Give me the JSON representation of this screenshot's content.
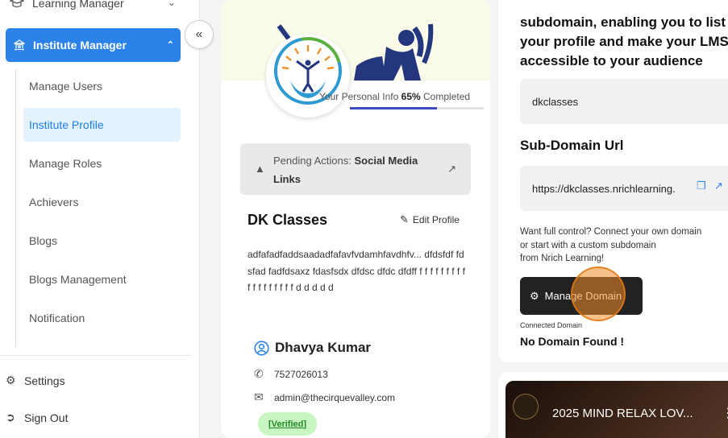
{
  "colors": {
    "primary": "#2b82e8",
    "active_bg": "#e3f2fd",
    "dark_button": "#222222",
    "verified_bg": "#c9f5c2",
    "progress": "#3b4bc4"
  },
  "sidebar": {
    "learning_manager": "Learning Manager",
    "institute_manager": "Institute Manager",
    "items": [
      {
        "label": "Manage Users",
        "active": false
      },
      {
        "label": "Institute Profile",
        "active": true
      },
      {
        "label": "Manage Roles",
        "active": false
      },
      {
        "label": "Achievers",
        "active": false
      },
      {
        "label": "Blogs",
        "active": false
      },
      {
        "label": "Blogs Management",
        "active": false
      },
      {
        "label": "Notification",
        "active": false
      }
    ],
    "settings": "Settings",
    "sign_out": "Sign Out",
    "collapse_icon": "double-chevron-left-icon"
  },
  "profile": {
    "progress_prefix": "Your Personal Info",
    "progress_percent": "65%",
    "progress_value": 0.65,
    "progress_suffix": "Completed",
    "pending_prefix": "Pending Actions:",
    "pending_value": "Social Media Links",
    "institute_name": "DK Classes",
    "edit_label": "Edit Profile",
    "about": "adfafadfaddsaadadfafavfvdamhfavdhfv... dfdsfdf fdsfad fadfdsaxz fdasfsdx dfdsc dfdc dfdff f f f f f f f f f f f f f f f f f f d d d d d",
    "person_name": "Dhavya Kumar",
    "phone": "7527026013",
    "email": "admin@thecirquevalley.com",
    "verified_label": "[Verified]"
  },
  "domain": {
    "intro": "subdomain, enabling you to list your profile and make your LMS accessible to your audience",
    "subdomain_value": "dkclasses",
    "subdomain_url_heading": "Sub-Domain Url",
    "subdomain_url": "https://dkclasses.nrichlearning.",
    "want_line1": "Want full control? Connect your own domain",
    "want_line2": "or start with a custom subdomain",
    "want_line3": "from Nrich Learning!",
    "manage_button": "Manage Domain",
    "connected_label": "Connected Domain",
    "connected_value": "No Domain Found !"
  },
  "video": {
    "title": "2025 MIND RELAX LOV..."
  }
}
